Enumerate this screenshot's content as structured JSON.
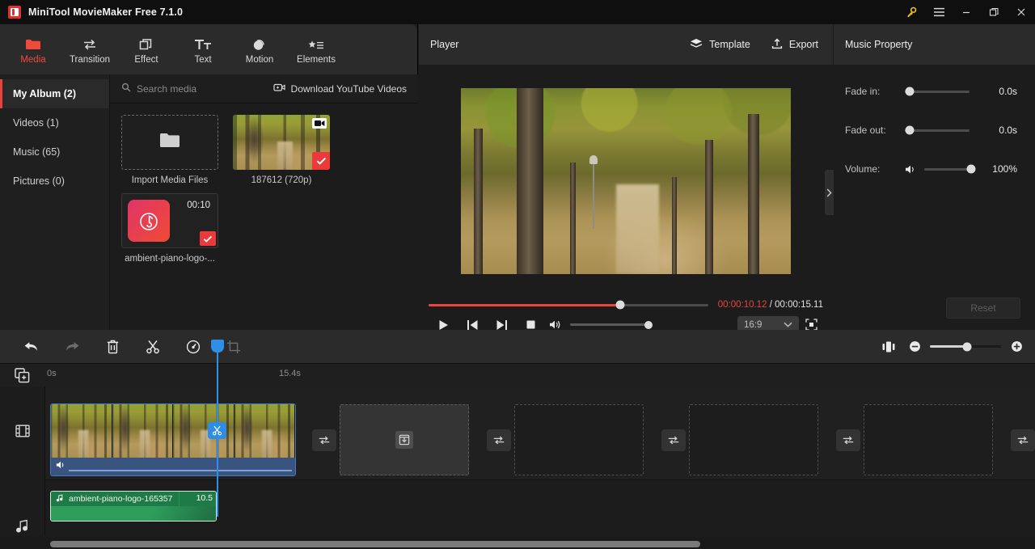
{
  "window": {
    "title": "MiniTool MovieMaker Free 7.1.0",
    "controls": {
      "key": "key-icon",
      "menu": "hamburger-menu-icon",
      "minimize": "–",
      "maximize": "maximize-icon",
      "close": "✕"
    }
  },
  "ribbon": {
    "items": [
      {
        "label": "Media",
        "icon": "folder-icon",
        "active": true
      },
      {
        "label": "Transition",
        "icon": "transition-arrows-icon",
        "active": false
      },
      {
        "label": "Effect",
        "icon": "layers-effect-icon",
        "active": false
      },
      {
        "label": "Text",
        "icon": "text-icon",
        "active": false
      },
      {
        "label": "Motion",
        "icon": "motion-circle-icon",
        "active": false
      },
      {
        "label": "Elements",
        "icon": "star-elements-icon",
        "active": false
      }
    ]
  },
  "library": {
    "categories": [
      {
        "label": "My Album (2)",
        "active": true
      },
      {
        "label": "Videos (1)",
        "active": false
      },
      {
        "label": "Music (65)",
        "active": false
      },
      {
        "label": "Pictures (0)",
        "active": false
      }
    ],
    "search_placeholder": "Search media",
    "youtube_label": "Download YouTube Videos",
    "import_label": "Import Media Files",
    "items": [
      {
        "name": "187612 (720p)",
        "type": "video",
        "selected": true,
        "duration": ""
      },
      {
        "name": "ambient-piano-logo-...",
        "type": "audio",
        "selected": true,
        "duration": "00:10"
      }
    ]
  },
  "player": {
    "title": "Player",
    "template_label": "Template",
    "export_label": "Export",
    "current_time": "00:00:10.12",
    "time_separator": "/",
    "total_time": "00:00:15.11",
    "progress_percent": 68.5,
    "aspect_ratio": "16:9",
    "volume_percent": 100
  },
  "music_property": {
    "title": "Music Property",
    "fade_in_label": "Fade in:",
    "fade_in_value": "0.0s",
    "fade_out_label": "Fade out:",
    "fade_out_value": "0.0s",
    "volume_label": "Volume:",
    "volume_value": "100%",
    "reset_label": "Reset"
  },
  "timeline": {
    "toolbar": [
      {
        "name": "undo",
        "icon": "undo-arrow-icon",
        "enabled": true
      },
      {
        "name": "redo",
        "icon": "redo-arrow-icon",
        "enabled": false
      },
      {
        "name": "delete",
        "icon": "trash-icon",
        "enabled": true
      },
      {
        "name": "split",
        "icon": "scissors-icon",
        "enabled": true
      },
      {
        "name": "speed",
        "icon": "speed-gauge-icon",
        "enabled": true
      },
      {
        "name": "crop",
        "icon": "crop-icon",
        "enabled": false
      }
    ],
    "zoom_minus": "−",
    "zoom_plus": "+",
    "zoom_percent": 52,
    "ruler_start": "0s",
    "ruler_mark": "15.4s",
    "video_clip": {
      "label": "",
      "selected": true
    },
    "audio_clip": {
      "label": "ambient-piano-logo-165357",
      "duration": "10.5"
    },
    "transition_slots": 4,
    "placeholder_slots": 4
  }
}
